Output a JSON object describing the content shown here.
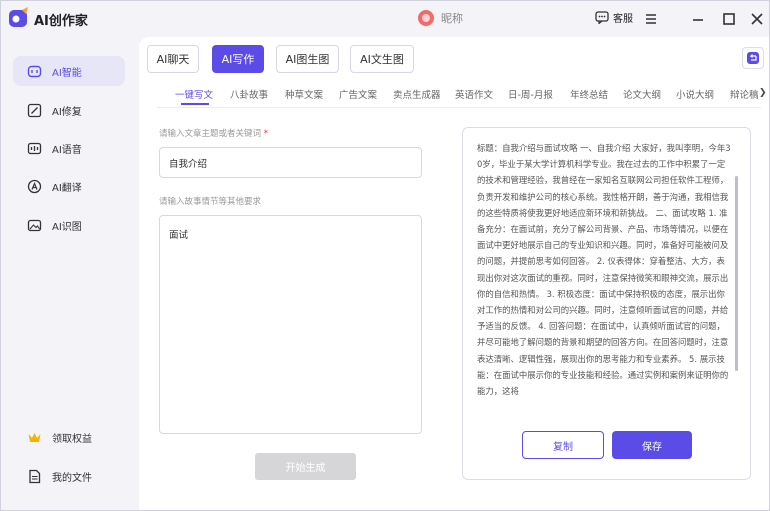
{
  "app": {
    "title": "AI创作家"
  },
  "header": {
    "nickname": "昵称",
    "kefu_label": "客服"
  },
  "sidebar": {
    "items": [
      {
        "label": "AI智能",
        "icon": "ai-chat-icon"
      },
      {
        "label": "AI修复",
        "icon": "ai-repair-icon"
      },
      {
        "label": "AI语音",
        "icon": "ai-voice-icon"
      },
      {
        "label": "AI翻译",
        "icon": "ai-translate-icon"
      },
      {
        "label": "AI识图",
        "icon": "ai-image-recognition-icon"
      }
    ],
    "bottom": [
      {
        "label": "领取权益",
        "icon": "crown-icon"
      },
      {
        "label": "我的文件",
        "icon": "file-icon"
      }
    ]
  },
  "top_tabs": [
    "AI聊天",
    "AI写作",
    "AI图生图",
    "AI文生图"
  ],
  "sub_tabs": [
    "一键写文",
    "八卦故事",
    "种草文案",
    "广告文案",
    "卖点生成器",
    "英语作文",
    "日-周-月报",
    "年终总结",
    "论文大纲",
    "小说大纲",
    "辩论稿"
  ],
  "form": {
    "topic_label": "请输入文章主题或者关键词",
    "topic_required": "*",
    "topic_value": "自我介绍",
    "story_label": "请输入故事情节等其他要求",
    "story_value": "面试",
    "generate_label": "开始生成"
  },
  "result": {
    "text": "标题：自我介绍与面试攻略 一、自我介绍 大家好，我叫李明，今年30岁，毕业于某大学计算机科学专业。我在过去的工作中积累了一定的技术和管理经验，我曾经在一家知名互联网公司担任软件工程师，负责开发和维护公司的核心系统。我性格开朗，善于沟通，我相信我的这些特质将使我更好地适应新环境和新挑战。 二、面试攻略 1. 准备充分：在面试前，充分了解公司背景、产品、市场等情况，以便在面试中更好地展示自己的专业知识和兴趣。同时，准备好可能被问及的问题，并提前思考如何回答。 2. 仪表得体：穿着整洁、大方，表现出你对这次面试的重视。同时，注意保持微笑和眼神交流，展示出你的自信和热情。 3. 积极态度：面试中保持积极的态度，展示出你对工作的热情和对公司的兴趣。同时，注意倾听面试官的问题，并给予适当的反馈。 4. 回答问题：在面试中，认真倾听面试官的问题，并尽可能地了解问题的背景和期望的回答方向。在回答问题时，注意表达清晰、逻辑性强，展现出你的思考能力和专业素养。 5. 展示技能：在面试中展示你的专业技能和经验。通过实例和案例来证明你的能力，这将",
    "copy_label": "复制",
    "save_label": "保存"
  },
  "colors": {
    "accent": "#5b4ce8",
    "background": "#f3f3f8"
  }
}
